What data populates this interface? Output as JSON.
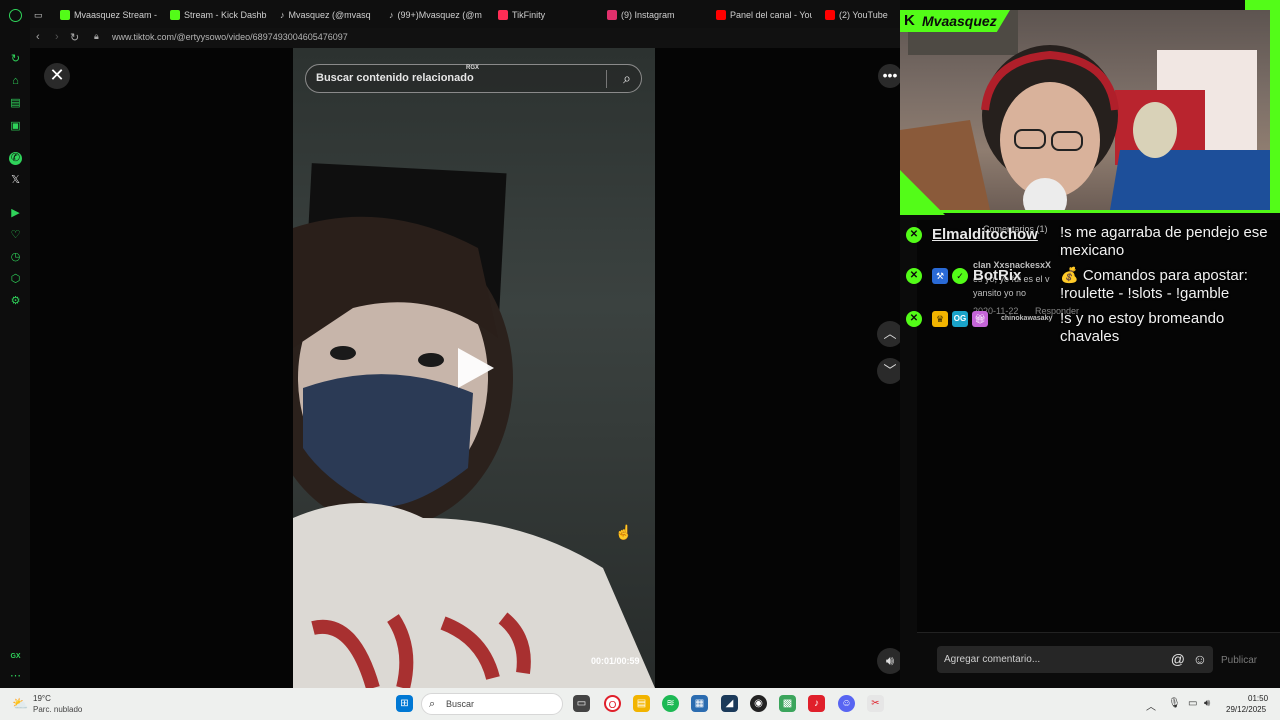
{
  "browser": {
    "tabs": [
      {
        "label": "Mvaasquez Stream -",
        "color": "#53fc18"
      },
      {
        "label": "Stream - Kick Dashb",
        "color": "#53fc18"
      },
      {
        "label": "Mvasquez (@mvasq",
        "color": "#ffffff"
      },
      {
        "label": "(99+)Mvasquez (@m",
        "color": "#ffffff"
      },
      {
        "label": "TikFinity",
        "color": "#ff2d55"
      },
      {
        "label": "(9) Instagram",
        "color": "#e1306c"
      },
      {
        "label": "Panel del canal - You",
        "color": "#ff0000"
      },
      {
        "label": "(2) YouTube",
        "color": "#ff0000"
      }
    ],
    "url": "www.tiktok.com/@ertyysowo/video/6897493004605476097",
    "lock_icon": "lock-icon",
    "back_icon": "back-icon",
    "forward_icon": "forward-icon",
    "reload_icon": "reload-icon"
  },
  "sidebar": {
    "icons": [
      "opera-logo-icon",
      "tabs-icon",
      "aria-icon",
      "news-icon",
      "notes-icon",
      "music-icon",
      "whatsapp-icon",
      "x-icon",
      "player-icon",
      "heart-icon",
      "history-icon",
      "extensions-icon",
      "settings-icon",
      "gx-icon",
      "more-icon"
    ],
    "gx_label": "GX"
  },
  "tiktok": {
    "search_placeholder": "Buscar contenido relacionado",
    "rgx_label": "RGX",
    "timecode": "00:01/00:59",
    "comment_placeholder": "Agregar comentario...",
    "publish_label": "Publicar",
    "faded_comments": {
      "header": "Comentarios (1)",
      "user": "clan XxsnackesxX",
      "text_line1": "es yo, yo fui es el v",
      "text_line2": "yansito yo no",
      "date": "2020-11-22",
      "reply": "Responder",
      "user2": "chinokawasaky"
    }
  },
  "stream_overlay": {
    "kick_logo": "K",
    "streamer_name": "Mvaasquez"
  },
  "chat": [
    {
      "user": "Elmalditochow",
      "message": "!s me agarraba de pendejo ese mexicano",
      "badges": []
    },
    {
      "user": "BotRix",
      "message": "💰 Comandos para apostar: !roulette - !slots - !gamble",
      "badges": [
        "bot-badge",
        "verified-badge"
      ]
    },
    {
      "user": "",
      "message": "!s y no estoy bromeando chavales",
      "badges": [
        "crown-badge",
        "og-badge",
        "gift-badge"
      ]
    }
  ],
  "taskbar": {
    "weather_temp": "19°C",
    "weather_desc": "Parc. nublado",
    "search_label": "Buscar",
    "time": "01:50",
    "date": "29/12/2025"
  },
  "colors": {
    "kick_green": "#53fc18",
    "opera_green": "#2fd35a"
  }
}
